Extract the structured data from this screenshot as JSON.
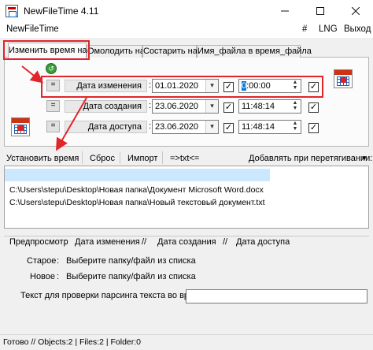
{
  "window": {
    "title": "NewFileTime 4.11",
    "menu": [
      {
        "label": "NewFileTime"
      },
      {
        "label": "#"
      },
      {
        "label": "LNG"
      },
      {
        "label": "Выход"
      }
    ]
  },
  "tabs": [
    {
      "label": "Изменить время на",
      "active": true
    },
    {
      "label": "Омолодить на",
      "active": false
    },
    {
      "label": "Состарить на",
      "active": false
    },
    {
      "label": "Имя_файла в время_файла",
      "active": false
    }
  ],
  "rows": [
    {
      "eq": "=",
      "label": "Дата изменения",
      "date": "01.01.2020",
      "date_checked": true,
      "time_highlight": "0",
      "time_rest": ":00:00",
      "time_checked": true
    },
    {
      "eq": "=",
      "label": "Дата создания",
      "date": "23.06.2020",
      "date_checked": true,
      "time_highlight": "",
      "time_rest": "11:48:14",
      "time_checked": true
    },
    {
      "eq": "=",
      "label": "Дата доступа",
      "date": "23.06.2020",
      "date_checked": true,
      "time_highlight": "",
      "time_rest": "11:48:14",
      "time_checked": true
    }
  ],
  "glyphs": {
    "colon": ":",
    "dropdown": "▾",
    "spin_up": "▲",
    "spin_down": "▼",
    "check": "✓"
  },
  "toolbar": {
    "set_time": "Установить время",
    "reset": "Сброс",
    "import": "Импорт",
    "txt": "=>txt<=",
    "drag_label": "Добавлять при перетягивании:",
    "drag_arrow": "▾"
  },
  "files": [
    "C:\\Users\\stepu\\Desktop\\Новая папка\\Документ Microsoft Word.docx",
    "C:\\Users\\stepu\\Desktop\\Новая папка\\Новый текстовый документ.txt"
  ],
  "preview": {
    "header": [
      "Предпросмотр",
      ":",
      "Дата изменения",
      "//",
      "Дата создания",
      "//",
      "Дата доступа"
    ],
    "old_label": "Старое",
    "new_label": "Новое",
    "colon": ":",
    "old_value": "Выберите папку/файл из списка",
    "new_value": "Выберите папку/файл из списка",
    "parse_label": "Текст для проверки парсинга текста во время",
    "parse_value": ""
  },
  "status": "Готово // Objects:2 | Files:2 | Folder:0",
  "colors": {
    "highlight_border": "#e0252b",
    "selection": "#0078d7",
    "list_highlight": "#cce8ff"
  }
}
